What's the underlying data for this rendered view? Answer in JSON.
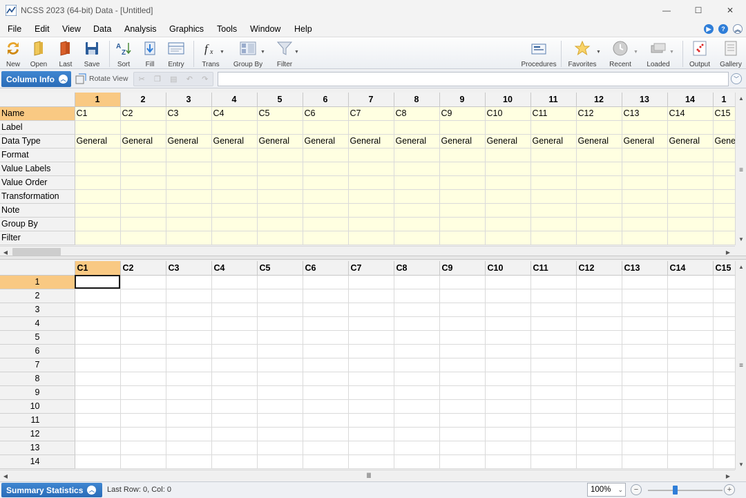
{
  "window": {
    "title": "NCSS 2023 (64-bit) Data - [Untitled]",
    "controls": {
      "minimize": "—",
      "maximize": "☐",
      "close": "✕"
    }
  },
  "menu": [
    "File",
    "Edit",
    "View",
    "Data",
    "Analysis",
    "Graphics",
    "Tools",
    "Window",
    "Help"
  ],
  "toolbar": {
    "new": "New",
    "open": "Open",
    "last": "Last",
    "save": "Save",
    "sort": "Sort",
    "fill": "Fill",
    "entry": "Entry",
    "trans": "Trans",
    "group_by": "Group By",
    "filter": "Filter",
    "procedures": "Procedures",
    "favorites": "Favorites",
    "recent": "Recent",
    "loaded": "Loaded",
    "output": "Output",
    "gallery": "Gallery"
  },
  "subbar": {
    "column_info": "Column Info",
    "rotate_view": "Rotate View",
    "formula_value": ""
  },
  "column_info": {
    "column_numbers": [
      "1",
      "2",
      "3",
      "4",
      "5",
      "6",
      "7",
      "8",
      "9",
      "10",
      "11",
      "12",
      "13",
      "14",
      "1"
    ],
    "row_labels": [
      "Name",
      "Label",
      "Data Type",
      "Format",
      "Value Labels",
      "Value Order",
      "Transformation",
      "Note",
      "Group By",
      "Filter"
    ],
    "names": [
      "C1",
      "C2",
      "C3",
      "C4",
      "C5",
      "C6",
      "C7",
      "C8",
      "C9",
      "C10",
      "C11",
      "C12",
      "C13",
      "C14",
      "C15"
    ],
    "data_types": [
      "General",
      "General",
      "General",
      "General",
      "General",
      "General",
      "General",
      "General",
      "General",
      "General",
      "General",
      "General",
      "General",
      "General",
      "Gene"
    ]
  },
  "data_grid": {
    "column_names": [
      "C1",
      "C2",
      "C3",
      "C4",
      "C5",
      "C6",
      "C7",
      "C8",
      "C9",
      "C10",
      "C11",
      "C12",
      "C13",
      "C14",
      "C15"
    ],
    "row_numbers": [
      "1",
      "2",
      "3",
      "4",
      "5",
      "6",
      "7",
      "8",
      "9",
      "10",
      "11",
      "12",
      "13",
      "14"
    ]
  },
  "status": {
    "summary_statistics": "Summary Statistics",
    "position": "Last Row: 0, Col: 0",
    "zoom": "100%"
  },
  "colors": {
    "accent": "#2a6cb8",
    "selected_header": "#f9c983",
    "info_cell": "#ffffe1"
  }
}
